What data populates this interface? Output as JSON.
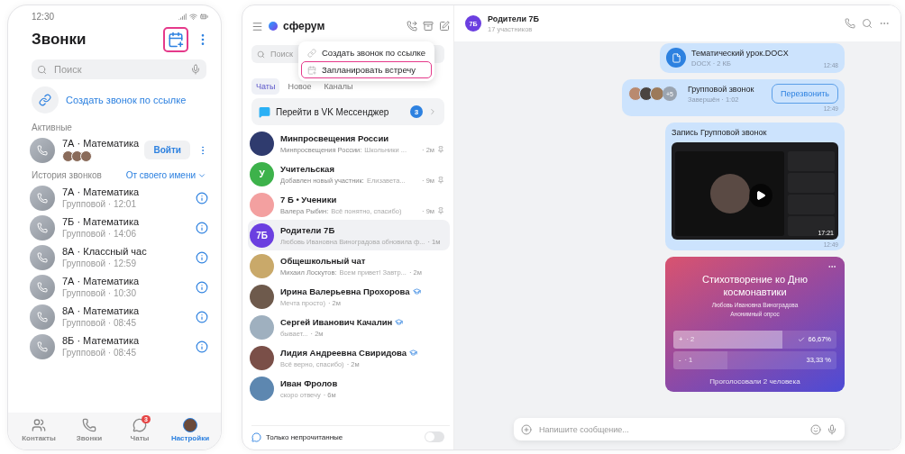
{
  "phone": {
    "status_time": "12:30",
    "title": "Звонки",
    "search": {
      "placeholder": "Поиск"
    },
    "create_link": "Создать звонок по ссылке",
    "active_section": "Активные",
    "active_calls": [
      {
        "title": "7А · Математика",
        "join": "Войти"
      }
    ],
    "history_section": "История звонков",
    "history_filter": "От своего имени",
    "history": [
      {
        "title": "7А · Математика",
        "subtitle": "Групповой · 12:01"
      },
      {
        "title": "7Б · Математика",
        "subtitle": "Групповой · 14:06"
      },
      {
        "title": "8А · Классный час",
        "subtitle": "Групповой · 12:59"
      },
      {
        "title": "7А · Математика",
        "subtitle": "Групповой · 10:30"
      },
      {
        "title": "8А · Математика",
        "subtitle": "Групповой · 08:45"
      },
      {
        "title": "8Б · Математика",
        "subtitle": "Групповой · 08:45"
      }
    ],
    "nav": [
      {
        "kind": "contacts",
        "label": "Контакты",
        "selected": false
      },
      {
        "kind": "calls",
        "label": "Звонки",
        "selected": false
      },
      {
        "kind": "chats",
        "label": "Чаты",
        "selected": false,
        "badge": "3"
      },
      {
        "kind": "profile",
        "label": "Настройки",
        "selected": true
      }
    ]
  },
  "sidebar": {
    "brand": "сферум",
    "search": {
      "placeholder": "Поиск"
    },
    "menu": [
      {
        "kind": "link",
        "label": "Создать звонок по ссылке",
        "selected": false
      },
      {
        "kind": "calendar",
        "label": "Запланировать встречу",
        "selected": true
      }
    ],
    "tabs": [
      {
        "label": "Чаты",
        "selected": true
      },
      {
        "label": "Новое",
        "selected": false
      },
      {
        "label": "Каналы",
        "selected": false
      }
    ],
    "banner": {
      "label": "Перейти в VK Мессенджер",
      "badge": "3"
    },
    "chats": [
      {
        "name": "Минпросвещения России",
        "sender": "Минпросвещения России:",
        "preview": "Школьники ...",
        "time": "· 2м",
        "pinned": true,
        "verified": false,
        "selected": false,
        "color": "#2f3b6e"
      },
      {
        "name": "Учительская",
        "avatar_text": "У",
        "sender": "Добавлен новый участник:",
        "preview": "Елизавета...",
        "time": "· 9м",
        "pinned": true,
        "verified": false,
        "selected": false,
        "color": "#3db24b"
      },
      {
        "name": "7 Б • Ученики",
        "sender": "Валера Рыбин:",
        "preview": "Всё понятно, спасибо)",
        "time": "· 9м",
        "pinned": true,
        "verified": false,
        "selected": false,
        "color": "#f3a0a0"
      },
      {
        "name": "Родители 7Б",
        "avatar_text": "7Б",
        "preview": "Любовь Ивановна Виноградова обновила ф...",
        "time": "· 1м",
        "pinned": false,
        "verified": false,
        "selected": true,
        "color": "#6b3fe0"
      },
      {
        "name": "Общешкольный чат",
        "sender": "Михаил Лоскутов:",
        "preview": "Всем привет! Завтр...",
        "time": "· 2м",
        "pinned": false,
        "verified": false,
        "selected": false,
        "color": "#c9a96a"
      },
      {
        "name": "Ирина Валерьевна Прохорова",
        "preview": "Мечта просто)",
        "time": "· 2м",
        "pinned": false,
        "verified": true,
        "selected": false,
        "color": "#6e5a4c"
      },
      {
        "name": "Сергей Иванович Качалин",
        "preview": "бывает...",
        "time": "· 2м",
        "pinned": false,
        "verified": true,
        "selected": false,
        "color": "#9fb0bf"
      },
      {
        "name": "Лидия Андреевна Свиридова",
        "preview": "Всё верно, спасибо)",
        "time": "· 2м",
        "pinned": false,
        "verified": true,
        "selected": false,
        "color": "#7a4f48"
      },
      {
        "name": "Иван Фролов",
        "preview": "скоро отвечу",
        "time": "· 6м",
        "pinned": false,
        "verified": false,
        "selected": false,
        "color": "#5d87b0"
      }
    ],
    "unread_only": {
      "label": "Только непрочитанные",
      "on": false
    }
  },
  "chat": {
    "title": "Родители 7Б",
    "avatar_text": "7Б",
    "subtitle": "17 участников",
    "messages": [
      {
        "kind": "file",
        "name": "Тематический урок.DOCX",
        "meta": "DOCX · 2 КБ",
        "time": "12:48"
      },
      {
        "kind": "call",
        "more": "+5",
        "title": "Групповой звонок",
        "meta": "Завершён · 1:02",
        "action": "Перезвонить",
        "time": "12:49"
      },
      {
        "kind": "video",
        "title": "Запись Групповой звонок",
        "duration": "17:21",
        "time": "12:49"
      },
      {
        "kind": "poll",
        "title": "Стихотворение ко Дню космонавтики",
        "author": "Любовь Ивановна Виноградова",
        "type": "Анонимный опрос",
        "options": [
          {
            "label": "+",
            "count": "· 2",
            "percent": "66,67%",
            "checked": true,
            "level": 0.6667
          },
          {
            "label": "-",
            "count": "· 1",
            "percent": "33,33 %",
            "checked": false,
            "level": 0.3333
          }
        ],
        "footer": "Проголосовали 2 человека"
      }
    ],
    "input": {
      "placeholder": "Напишите сообщение..."
    }
  }
}
